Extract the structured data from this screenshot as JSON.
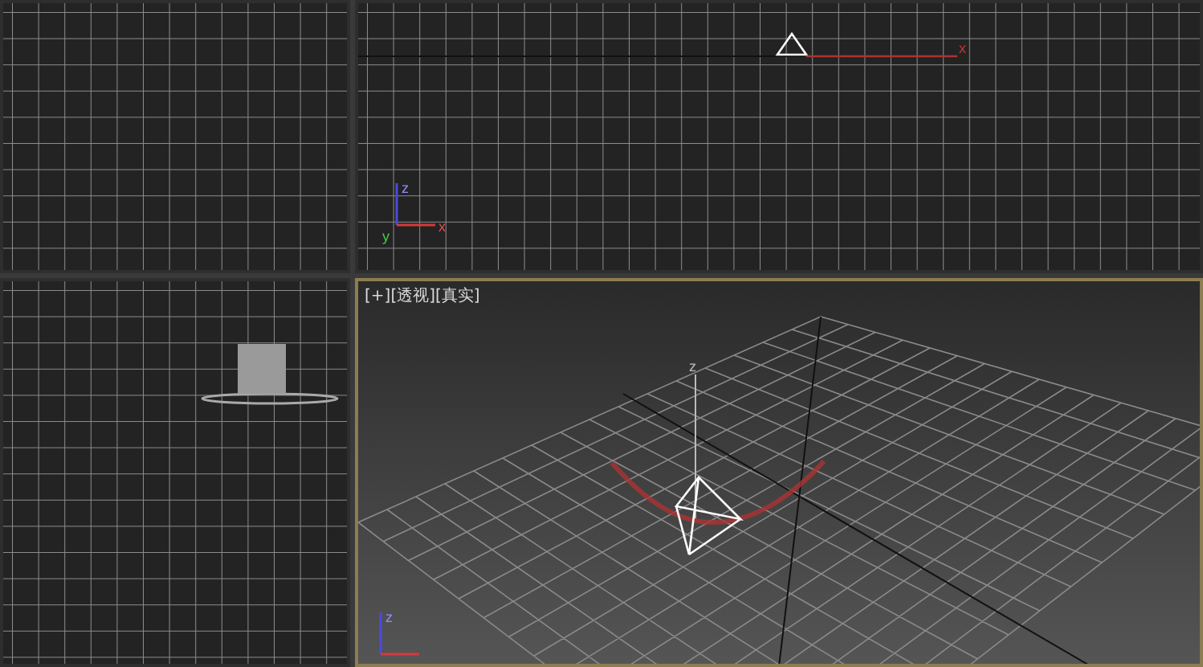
{
  "viewports": [
    {
      "kind": "empty",
      "active": false
    },
    {
      "kind": "light",
      "active": false,
      "gizmo_label": "x",
      "tripod": [
        "z",
        "y",
        "x"
      ]
    },
    {
      "kind": "box",
      "active": false
    },
    {
      "kind": "perspective",
      "active": true,
      "labels": [
        "[+]",
        "[透视]",
        "[真实]"
      ],
      "gizmo_label": "z",
      "tripod": [
        "z"
      ]
    }
  ]
}
